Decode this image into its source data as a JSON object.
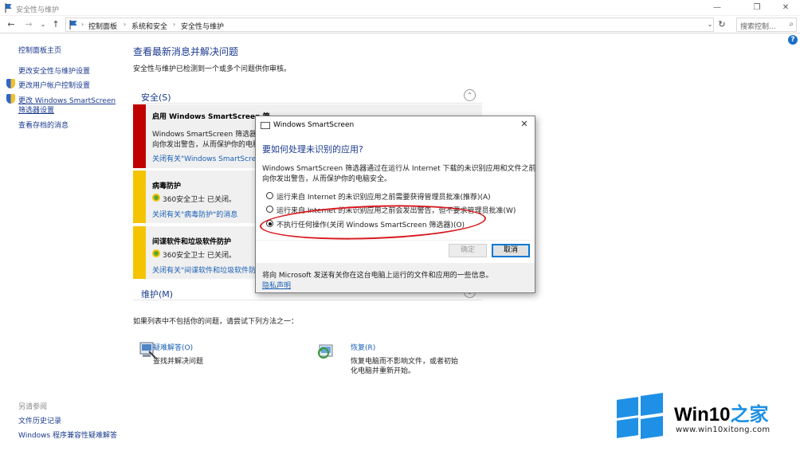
{
  "window": {
    "title": "安全性与维护",
    "min": "—",
    "max": "❐",
    "close": "✕"
  },
  "address": {
    "crumbs": [
      "控制面板",
      "系统和安全",
      "安全性与维护"
    ],
    "search_placeholder": "搜索控制..."
  },
  "nav": {
    "home": "控制面板主页",
    "items": [
      "更改安全性与维护设置",
      "更改用户帐户控制设置",
      "更改 Windows SmartScreen",
      "筛选器设置",
      "查看存档的消息"
    ],
    "see_also_label": "另请参阅",
    "see_also": [
      "文件历史记录",
      "Windows 程序兼容性疑难解答"
    ]
  },
  "main": {
    "title": "查看最新消息并解决问题",
    "subtitle": "安全性与维护已检测到一个或多个问题供你审核。",
    "security_label": "安全(S)",
    "maintenance_label": "维护(M)",
    "cards": [
      {
        "heading": "启用 Windows SmartScreen 筛",
        "line1": "Windows SmartScreen 筛选器",
        "line2": "向你发出警告，从而保护你的电脑",
        "link": "关闭有关\"Windows SmartScreen",
        "color": "#c00000"
      },
      {
        "heading": "病毒防护",
        "status": "360安全卫士 已关闭。",
        "link": "关闭有关\"病毒防护\"的消息",
        "color": "#f5c400"
      },
      {
        "heading": "间谍软件和垃圾软件防护",
        "status": "360安全卫士 已关闭。",
        "link": "关闭有关\"间谍软件和垃圾软件防",
        "color": "#f5c400"
      }
    ],
    "not_found": "如果列表中不包括你的问题，请尝试下列方法之一：",
    "tools": [
      {
        "title": "疑难解答(O)",
        "desc1": "查找并解决问题",
        "desc2": ""
      },
      {
        "title": "恢复(R)",
        "desc1": "恢复电脑而不影响文件，或者初始",
        "desc2": "化电脑并重新开始。"
      }
    ]
  },
  "dialog": {
    "title": "Windows SmartScreen",
    "heading": "要如何处理未识别的应用?",
    "body1": "Windows SmartScreen 筛选器通过在运行从 Internet 下载的未识别应用和文件之前",
    "body2": "向你发出警告，从而保护你的电脑安全。",
    "options": [
      "运行来自 Internet 的未识别应用之前需要获得管理员批准(推荐)(A)",
      "运行来自 Internet 的未识别应用之前会发出警告，但不要求管理员批准(W)",
      "不执行任何操作(关闭 Windows SmartScreen 筛选器)(O)"
    ],
    "selected_option": 2,
    "ok": "确定",
    "cancel": "取消",
    "footer": "将向 Microsoft 发送有关你在这台电脑上运行的文件和应用的一些信息。",
    "privacy": "隐私声明"
  },
  "watermark": {
    "brand_a": "Win10",
    "brand_b": "之家",
    "url": "www.win10xitong.com"
  }
}
